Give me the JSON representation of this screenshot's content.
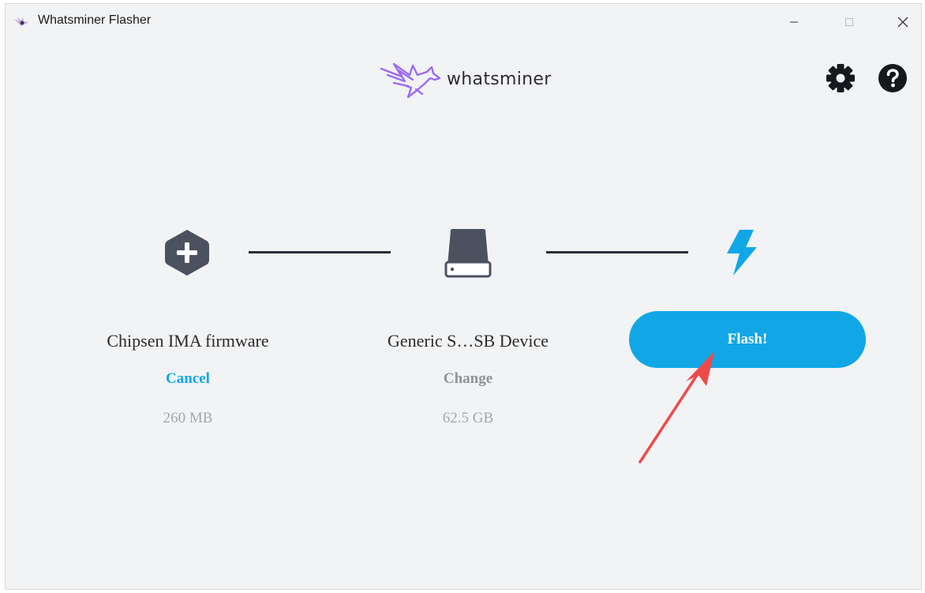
{
  "window": {
    "title": "Whatsminer Flasher"
  },
  "header": {
    "logo_text": "whatsminer"
  },
  "steps": {
    "image": {
      "name": "Chipsen IMA firmware",
      "action": "Cancel",
      "size": "260 MB"
    },
    "target": {
      "name": "Generic S…SB Device",
      "action": "Change",
      "size": "62.5 GB"
    },
    "flash": {
      "button_label": "Flash!"
    }
  },
  "colors": {
    "accent": "#11a7e6",
    "icon_dark": "#4c5160",
    "muted": "#a3a6ab",
    "annotation_arrow": "#ef4a4a",
    "logo_purple": "#9b6cf2"
  },
  "icons": {
    "app": "bird-icon",
    "settings": "gear-icon",
    "help": "question-icon",
    "add": "plus-hexagon-icon",
    "drive": "hard-drive-icon",
    "flash": "lightning-icon"
  }
}
